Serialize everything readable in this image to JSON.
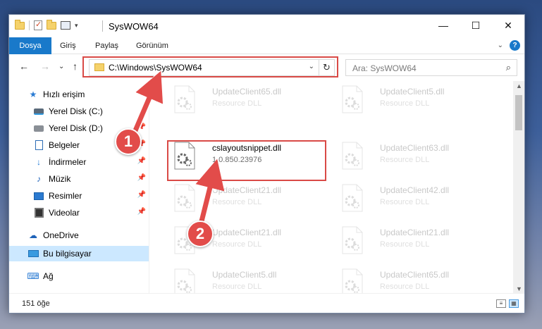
{
  "window": {
    "title": "SysWOW64",
    "controls": {
      "minimize": "—",
      "maximize": "☐",
      "close": "✕"
    }
  },
  "quick_access": {
    "caret": "▾"
  },
  "ribbon": {
    "tabs": [
      "Dosya",
      "Giriş",
      "Paylaş",
      "Görünüm"
    ],
    "expand": "⌄",
    "help": "?"
  },
  "address": {
    "path": "C:\\Windows\\SysWOW64",
    "dropdown": "⌄",
    "refresh": "↻"
  },
  "nav_buttons": {
    "back": "←",
    "forward": "→",
    "recent": "⌄",
    "up": "↑"
  },
  "search": {
    "placeholder": "Ara: SysWOW64",
    "icon": "⌕"
  },
  "sidebar": {
    "items": [
      {
        "label": "Hızlı erişim",
        "icon": "star-icon"
      },
      {
        "label": "Yerel Disk (C:)",
        "icon": "drive-c-icon"
      },
      {
        "label": "Yerel Disk (D:)",
        "icon": "drive-icon",
        "pinned": true
      },
      {
        "label": "Belgeler",
        "icon": "documents-icon",
        "pinned": true
      },
      {
        "label": "İndirmeler",
        "icon": "downloads-icon",
        "pinned": true
      },
      {
        "label": "Müzik",
        "icon": "music-icon",
        "pinned": true
      },
      {
        "label": "Resimler",
        "icon": "pictures-icon",
        "pinned": true
      },
      {
        "label": "Videolar",
        "icon": "videos-icon",
        "pinned": true
      },
      {
        "label": "OneDrive",
        "icon": "onedrive-icon"
      },
      {
        "label": "Bu bilgisayar",
        "icon": "this-pc-icon",
        "selected": true
      },
      {
        "label": "Ağ",
        "icon": "network-icon"
      }
    ],
    "pin_glyph": "📌"
  },
  "files": {
    "left": [
      {
        "name": "UpdateClient65.dll",
        "sub": "Resource DLL"
      },
      {
        "name": "cslayoutsnippet.dll",
        "sub": "1.0.850.23976",
        "highlighted": true
      },
      {
        "name": "UpdateClient21.dll",
        "sub": "Resource DLL"
      },
      {
        "name": "UpdateClient21.dll",
        "sub": "Resource DLL"
      },
      {
        "name": "UpdateClient5.dll",
        "sub": "Resource DLL"
      }
    ],
    "right": [
      {
        "name": "UpdateClient5.dll",
        "sub": "Resource DLL"
      },
      {
        "name": "UpdateClient63.dll",
        "sub": "Resource DLL"
      },
      {
        "name": "UpdateClient42.dll",
        "sub": "Resource DLL"
      },
      {
        "name": "UpdateClient21.dll",
        "sub": "Resource DLL"
      },
      {
        "name": "UpdateClient65.dll",
        "sub": "Resource DLL"
      }
    ]
  },
  "status": {
    "count": "151 öğe"
  },
  "scrollbar": {
    "up": "▲",
    "down": "▼"
  },
  "annotations": {
    "step1": "1",
    "step2": "2",
    "accent": "#e24c4a"
  }
}
